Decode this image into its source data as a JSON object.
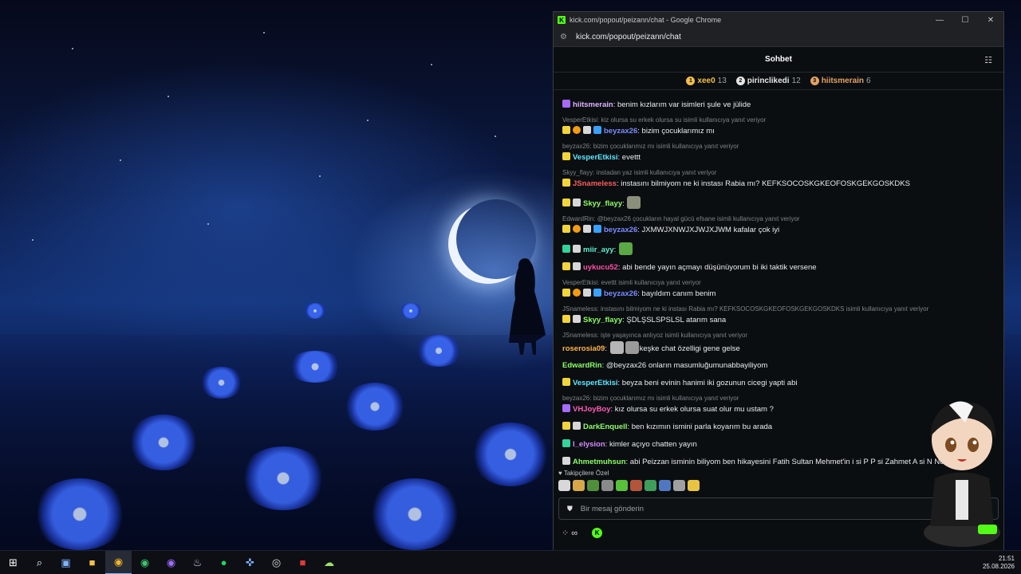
{
  "window": {
    "title": "kick.com/popout/peizann/chat - Google Chrome",
    "url": "kick.com/popout/peizann/chat",
    "favicon_letter": "K",
    "minimize": "—",
    "maximize": "☐",
    "close": "✕"
  },
  "chat": {
    "title": "Sohbet",
    "leaderboard": [
      {
        "rank": "1",
        "name": "xee0",
        "count": "13",
        "color": "#f5c04a"
      },
      {
        "rank": "2",
        "name": "pirinclikedi",
        "count": "12",
        "color": "#e6e6e6"
      },
      {
        "rank": "3",
        "name": "hiitsmerain",
        "count": "6",
        "color": "#e2a265"
      }
    ],
    "messages": [
      {
        "user": "hiitsmerain",
        "text": "benim kızlarım var isimleri şule ve jülide"
      },
      {
        "reply": "VesperEtkisi: kiz olursa su erkek olursa su isimli kullanıcıya yanıt veriyor",
        "user": "beyzax26",
        "text": "bizim çocuklarımız mı"
      },
      {
        "reply": "beyzax26: bizim çocuklarımız mı isimli kullanıcıya yanıt veriyor",
        "user": "VesperEtkisi",
        "text": "evettt"
      },
      {
        "reply": "Skyy_flayy: instadan yaz isimli kullanıcıya yanıt veriyor",
        "user": "JSnameless",
        "text": "instasını bilmiyom ne ki instası Rabia mı? KEFKSOCOSKGKEOFOSKGEKGOSKDKS"
      },
      {
        "user": "Skyy_flayy",
        "text": ""
      },
      {
        "reply": "EdwardRin: @beyzax26 çocukların hayal gücü efsane isimli kullanıcıya yanıt veriyor",
        "user": "beyzax26",
        "text": "JXMWJXNWJXJWJXJWM kafalar çok iyi"
      },
      {
        "user": "miir_ayy",
        "text": ""
      },
      {
        "user": "uykucu52",
        "text": "abi bende yayın açmayı düşünüyorum bi iki taktik versene"
      },
      {
        "reply": "VesperEtkisi: evettt isimli kullanıcıya yanıt veriyor",
        "user": "beyzax26",
        "text": "bayıldım canım benim"
      },
      {
        "reply": "JSnameless: instasını bilmiyom ne ki instası Rabia mı? KEFKSOCOSKGKEOFOSKGEKGOSKDKS isimli kullanıcıya yanıt veriyor",
        "user": "Skyy_flayy",
        "text": "ŞDLŞSLSPSLSL atarım sana"
      },
      {
        "reply": "JSnameless: işte yaşayınca anlıyoz isimli kullanıcıya yanıt veriyor",
        "user": "roserosia09",
        "text": "keşke chat özelligi gene gelse"
      },
      {
        "user": "EdwardRin",
        "text": "@beyzax26 onların masumluğumunabbayiliyom"
      },
      {
        "user": "VesperEtkisi",
        "text": "beyza beni evinin hanimi iki gozunun cicegi yapti abi"
      },
      {
        "reply": "beyzax26: bizim çocuklarımız mı isimli kullanıcıya yanıt veriyor",
        "user": "VHJoyBoy",
        "text": "kız olursa su erkek olursa suat olur mu ustam ?"
      },
      {
        "user": "DarkEnquell",
        "text": "ben kızımın ismini parla koyarım bu arada"
      },
      {
        "user": "l_elysion",
        "text": "kimler açıyo chatten yayın"
      },
      {
        "user": "Ahmetmuhsun",
        "text": "abi Peizzan isminin biliyom ben hikayesini Fatih Sultan Mehmet'in i si P P si Zahmet A si N Nesi"
      }
    ],
    "followers_label": "Takipçilere Özel",
    "input_placeholder": "Bir mesaj gönderin",
    "infinity": "∞",
    "coin": "K"
  },
  "colors": {
    "kick_green": "#53fc18",
    "panel_bg": "#0b0e11"
  },
  "taskbar": {
    "time": "21:51",
    "date": "25.08.2026"
  }
}
